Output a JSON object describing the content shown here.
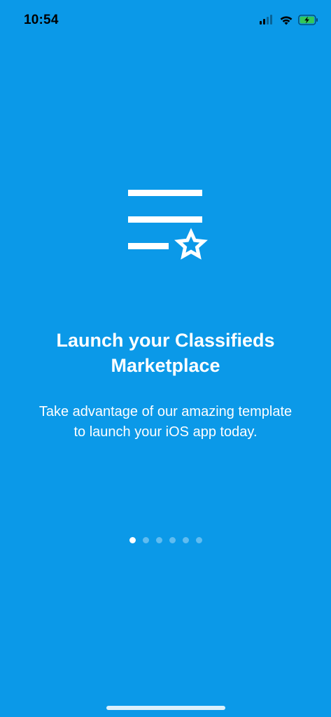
{
  "status_bar": {
    "time": "10:54",
    "icons": [
      "cellular-signal-icon",
      "wifi-icon",
      "battery-charging-icon"
    ],
    "battery_color": "#32c759"
  },
  "onboarding": {
    "logo_icon": "list-star-icon",
    "title": "Launch your Classifieds Marketplace",
    "description": "Take advantage of our amazing template to launch your iOS app today.",
    "page_count": 6,
    "current_page": 1
  },
  "colors": {
    "background": "#0b99e8",
    "text": "#ffffff"
  }
}
